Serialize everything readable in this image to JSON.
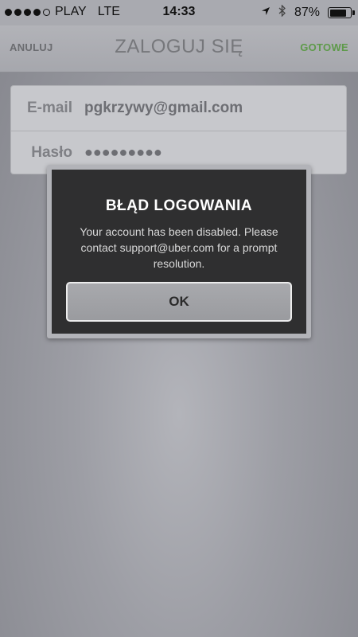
{
  "status_bar": {
    "carrier": "PLAY",
    "network": "LTE",
    "time": "14:33",
    "battery": "87%",
    "battery_level": 0.87,
    "signal": [
      true,
      true,
      true,
      true,
      false
    ],
    "icons": [
      "location-icon",
      "bluetooth-icon",
      "battery-icon"
    ]
  },
  "nav": {
    "cancel_label": "ANULUJ",
    "title": "ZALOGUJ SIĘ",
    "done_label": "GOTOWE"
  },
  "form": {
    "email_label": "E-mail",
    "email_value": "pgkrzywy@gmail.com",
    "password_label": "Hasło",
    "password_value": "●●●●●●●●●"
  },
  "alert": {
    "title": "BŁĄD LOGOWANIA",
    "message": "Your account has been disabled. Please contact support@uber.com for a prompt resolution.",
    "ok_label": "OK"
  },
  "colors": {
    "accent_done": "#5e9a4a",
    "alert_bg": "#2f2f30"
  }
}
